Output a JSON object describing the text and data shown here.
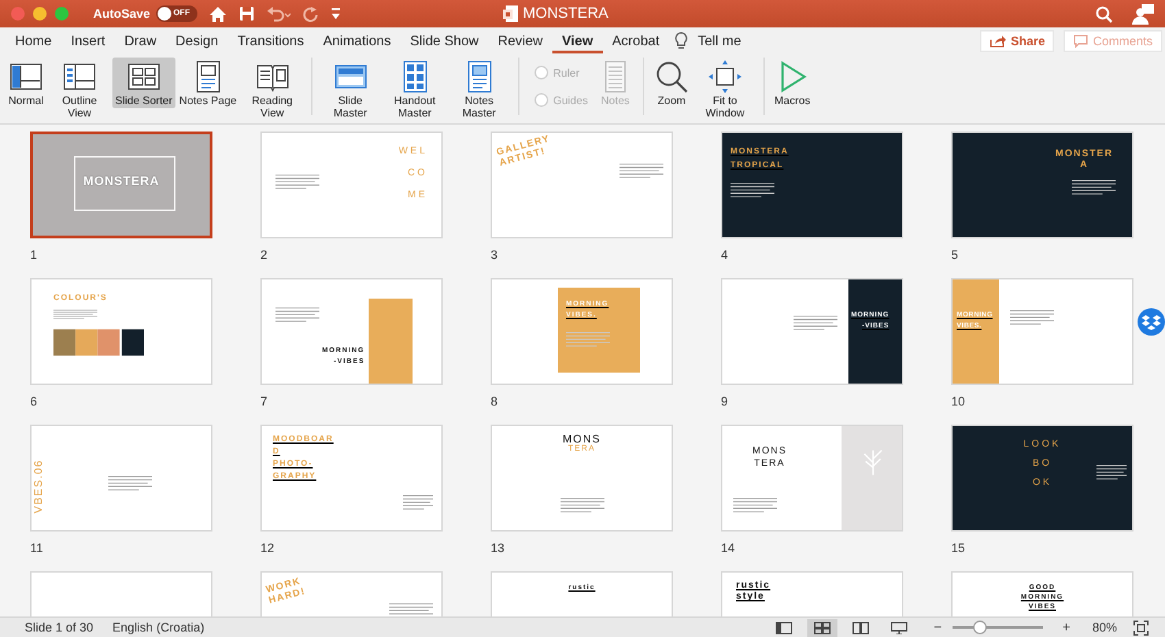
{
  "window": {
    "title": "MONSTERA"
  },
  "quick_access": {
    "autosave_label": "AutoSave",
    "autosave_state": "OFF",
    "autosave_on": false
  },
  "tabs": [
    {
      "label": "Home",
      "selected": false
    },
    {
      "label": "Insert",
      "selected": false
    },
    {
      "label": "Draw",
      "selected": false
    },
    {
      "label": "Design",
      "selected": false
    },
    {
      "label": "Transitions",
      "selected": false
    },
    {
      "label": "Animations",
      "selected": false
    },
    {
      "label": "Slide Show",
      "selected": false
    },
    {
      "label": "Review",
      "selected": false
    },
    {
      "label": "View",
      "selected": true
    },
    {
      "label": "Acrobat",
      "selected": false
    }
  ],
  "tell_me": "Tell me",
  "share_button": "Share",
  "comments_button": "Comments",
  "ribbon": {
    "groups": [
      {
        "items": [
          {
            "kind": "normal",
            "label": "Normal",
            "selected": false
          },
          {
            "kind": "outline",
            "label": "Outline View",
            "selected": false
          },
          {
            "kind": "sorter",
            "label": "Slide Sorter",
            "selected": true
          },
          {
            "kind": "notes-page",
            "label": "Notes Page",
            "selected": false
          },
          {
            "kind": "reading",
            "label": "Reading View",
            "selected": false
          }
        ]
      },
      {
        "items": [
          {
            "kind": "slide-master",
            "label": "Slide Master"
          },
          {
            "kind": "handout-master",
            "label": "Handout Master"
          },
          {
            "kind": "notes-master",
            "label": "Notes Master"
          }
        ]
      },
      {
        "items": [
          {
            "kind": "checkbox",
            "label": "Ruler",
            "checked": false,
            "disabled": true
          },
          {
            "kind": "checkbox",
            "label": "Guides",
            "checked": false,
            "disabled": true
          },
          {
            "kind": "notes",
            "label": "Notes",
            "disabled": true
          }
        ]
      },
      {
        "items": [
          {
            "kind": "zoom",
            "label": "Zoom"
          },
          {
            "kind": "fit",
            "label": "Fit to Window"
          }
        ]
      },
      {
        "items": [
          {
            "kind": "macros",
            "label": "Macros"
          }
        ]
      }
    ]
  },
  "slides": [
    {
      "number": "1",
      "kind": "gray-framed",
      "selected": true,
      "titles": [
        {
          "text": "MONSTERA",
          "kind": "light"
        }
      ]
    },
    {
      "number": "2",
      "kind": "light-right-stack",
      "selected": false,
      "titles": [
        {
          "text": "WEL",
          "kind": "accent"
        },
        {
          "text": "CO",
          "kind": "accent"
        },
        {
          "text": "ME",
          "kind": "accent"
        }
      ]
    },
    {
      "number": "3",
      "kind": "light-tilted",
      "selected": false,
      "titles": [
        {
          "text": "GALLERY",
          "kind": "accent"
        },
        {
          "text": "ARTIST!",
          "kind": "accent"
        }
      ]
    },
    {
      "number": "4",
      "kind": "dark-left-underlined",
      "selected": false,
      "titles": [
        {
          "text": "MONSTERA",
          "kind": "accent"
        },
        {
          "text": "TROPICAL",
          "kind": "accent"
        }
      ]
    },
    {
      "number": "5",
      "kind": "dark-right-center",
      "selected": false,
      "titles": [
        {
          "text": "MONSTER",
          "kind": "accent"
        },
        {
          "text": "A",
          "kind": "accent"
        }
      ]
    },
    {
      "number": "6",
      "kind": "light-palette",
      "selected": false,
      "titles": [
        {
          "text": "COLOUR'S",
          "kind": "accent"
        }
      ]
    },
    {
      "number": "7",
      "kind": "light-orange-block",
      "selected": false,
      "titles": [
        {
          "text": "MORNING",
          "kind": "ink"
        },
        {
          "text": "-VIBES",
          "kind": "ink"
        }
      ]
    },
    {
      "number": "8",
      "kind": "light-orange-box",
      "selected": false,
      "titles": [
        {
          "text": "MORNING",
          "kind": "light"
        },
        {
          "text": "VIBES.",
          "kind": "light"
        }
      ]
    },
    {
      "number": "9",
      "kind": "light-dark-panel",
      "selected": false,
      "titles": [
        {
          "text": "MORNING",
          "kind": "light"
        },
        {
          "text": "-VIBES",
          "kind": "light"
        }
      ]
    },
    {
      "number": "10",
      "kind": "light-orange-panel",
      "selected": false,
      "titles": [
        {
          "text": "MORNING",
          "kind": "light"
        },
        {
          "text": "VIBES.",
          "kind": "light"
        }
      ]
    },
    {
      "number": "11",
      "kind": "light-vertical",
      "selected": false,
      "titles": [
        {
          "text": "VBES.06",
          "kind": "accent"
        }
      ]
    },
    {
      "number": "12",
      "kind": "light-left-underlined",
      "selected": false,
      "titles": [
        {
          "text": "MOODBOAR",
          "kind": "accent"
        },
        {
          "text": "D",
          "kind": "accent"
        },
        {
          "text": "PHOTO-",
          "kind": "accent"
        },
        {
          "text": "GRAPHY",
          "kind": "accent"
        }
      ]
    },
    {
      "number": "13",
      "kind": "light-center-ruled",
      "selected": false,
      "titles": [
        {
          "text": "MONS",
          "kind": "ink"
        },
        {
          "text": "TERA",
          "kind": "accent"
        }
      ]
    },
    {
      "number": "14",
      "kind": "light-gray-split",
      "selected": false,
      "titles": [
        {
          "text": "MONS",
          "kind": "ink"
        },
        {
          "text": "TERA",
          "kind": "ink"
        }
      ]
    },
    {
      "number": "15",
      "kind": "dark-center",
      "selected": false,
      "titles": [
        {
          "text": "LOOK",
          "kind": "accent"
        },
        {
          "text": "BO",
          "kind": "accent"
        },
        {
          "text": "OK",
          "kind": "accent"
        }
      ]
    },
    {
      "kind": "light-top-center",
      "selected": false
    },
    {
      "kind": "light-tilted",
      "selected": false,
      "titles": [
        {
          "text": "WORK",
          "kind": "accent"
        },
        {
          "text": "HARD!",
          "kind": "accent"
        }
      ]
    },
    {
      "kind": "light-top-center",
      "selected": false,
      "titles": [
        {
          "text": "rustic",
          "kind": "ink"
        }
      ]
    },
    {
      "kind": "light-top-left",
      "selected": false,
      "titles": [
        {
          "text": "rustic",
          "kind": "ink"
        },
        {
          "text": "style",
          "kind": "ink"
        }
      ]
    },
    {
      "kind": "light-top-center",
      "selected": false,
      "titles": [
        {
          "text": "GOOD",
          "kind": "ink"
        },
        {
          "text": "MORNING",
          "kind": "ink"
        },
        {
          "text": "VIBES",
          "kind": "ink"
        }
      ]
    }
  ],
  "status_bar": {
    "slide_info": "Slide 1 of 30",
    "language": "English (Croatia)",
    "views": [
      {
        "kind": "normal",
        "selected": false
      },
      {
        "kind": "sorter",
        "selected": true
      },
      {
        "kind": "reading",
        "selected": false
      },
      {
        "kind": "slideshow",
        "selected": false
      }
    ],
    "zoom_out": "−",
    "zoom_in": "+",
    "zoom": {
      "level": 0.3
    },
    "zoom_value": "80%"
  }
}
